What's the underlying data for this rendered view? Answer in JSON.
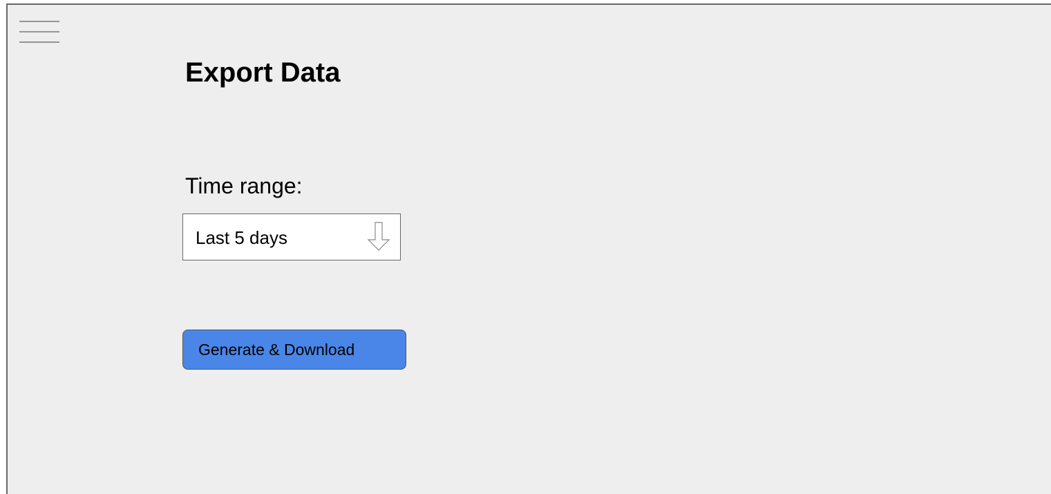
{
  "header": {
    "menu_icon": "hamburger-menu-icon"
  },
  "page": {
    "title": "Export Data"
  },
  "time_range": {
    "label": "Time range:",
    "selected_value": "Last 5 days",
    "arrow_icon": "down-arrow-icon"
  },
  "actions": {
    "generate_label": "Generate & Download"
  },
  "colors": {
    "background": "#eeeeee",
    "button_primary": "#4a86e8",
    "border": "#666666"
  }
}
